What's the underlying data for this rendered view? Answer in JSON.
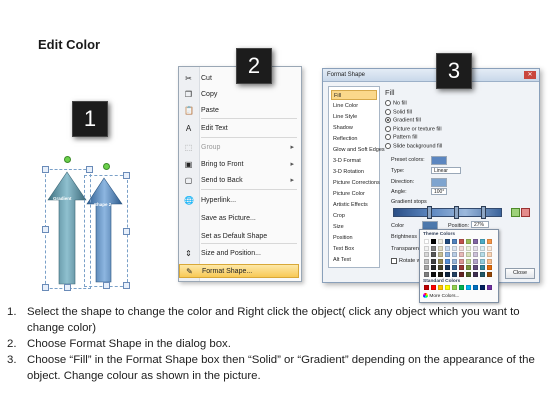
{
  "title": "Edit Color",
  "badges": [
    "1",
    "2",
    "3"
  ],
  "shapes": {
    "left_arrow_label": "Gradient",
    "right_arrow_label": "Shape 2",
    "colors": {
      "arrow_left": "#6f9fb0",
      "arrow_right": "#5b8fc4",
      "selection": "#7aa0c8",
      "rotate_handle": "#6bd04a"
    }
  },
  "context_menu": {
    "items": [
      {
        "label": "Cut",
        "icon": "scissors-icon",
        "glyph": "✂",
        "enabled": true,
        "submenu": false
      },
      {
        "label": "Copy",
        "icon": "copy-icon",
        "glyph": "❐",
        "enabled": true,
        "submenu": false
      },
      {
        "label": "Paste",
        "icon": "paste-icon",
        "glyph": "📋",
        "enabled": true,
        "submenu": false
      },
      {
        "label": "Edit Text",
        "icon": "edit-text-icon",
        "glyph": "A",
        "enabled": true,
        "submenu": false
      },
      {
        "label": "Group",
        "icon": "group-icon",
        "glyph": "⬚",
        "enabled": false,
        "submenu": true
      },
      {
        "label": "Bring to Front",
        "icon": "bring-front-icon",
        "glyph": "▣",
        "enabled": true,
        "submenu": true
      },
      {
        "label": "Send to Back",
        "icon": "send-back-icon",
        "glyph": "▢",
        "enabled": true,
        "submenu": true
      },
      {
        "label": "Hyperlink...",
        "icon": "hyperlink-icon",
        "glyph": "🌐",
        "enabled": true,
        "submenu": false
      },
      {
        "label": "Save as Picture...",
        "icon": "",
        "glyph": "",
        "enabled": true,
        "submenu": false
      },
      {
        "label": "Set as Default Shape",
        "icon": "",
        "glyph": "",
        "enabled": true,
        "submenu": false
      },
      {
        "label": "Size and Position...",
        "icon": "size-position-icon",
        "glyph": "⇕",
        "enabled": true,
        "submenu": false
      },
      {
        "label": "Format Shape...",
        "icon": "format-shape-icon",
        "glyph": "✎",
        "enabled": true,
        "submenu": false,
        "highlighted": true
      }
    ]
  },
  "format_dialog": {
    "title": "Format Shape",
    "nav": [
      "Fill",
      "Line Color",
      "Line Style",
      "Shadow",
      "Reflection",
      "Glow and Soft Edges",
      "3-D Format",
      "3-D Rotation",
      "Picture Corrections",
      "Picture Color",
      "Artistic Effects",
      "Crop",
      "Size",
      "Position",
      "Text Box",
      "Alt Text"
    ],
    "selected_nav": "Fill",
    "fill_heading": "Fill",
    "options": [
      "No fill",
      "Solid fill",
      "Gradient fill",
      "Picture or texture fill",
      "Pattern fill",
      "Slide background fill"
    ],
    "selected_option": "Gradient fill",
    "preset_colors_label": "Preset colors:",
    "type_label": "Type:",
    "type_value": "Linear",
    "direction_label": "Direction:",
    "angle_label": "Angle:",
    "angle_value": "100°",
    "gradient_stops_label": "Gradient stops",
    "color_label": "Color",
    "position_label": "Position:",
    "position_value": "27%",
    "brightness_label": "Brightness",
    "transparency_label": "Transparency",
    "rotate_label": "Rotate w",
    "close_label": "Close",
    "color_picker": {
      "theme_label": "Theme Colors",
      "standard_label": "Standard Colors",
      "more_label": "More Colors..."
    }
  },
  "instructions": [
    {
      "num": "1.",
      "text": "Select the shape to change the color and Right click the object( click any object which you want to change color)"
    },
    {
      "num": "2.",
      "text": "Choose Format Shape in the dialog box."
    },
    {
      "num": "3.",
      "text": "Choose “Fill” in the Format Shape box then “Solid” or “Gradient” depending on the appearance of the object. Change colour as shown in the picture."
    }
  ]
}
